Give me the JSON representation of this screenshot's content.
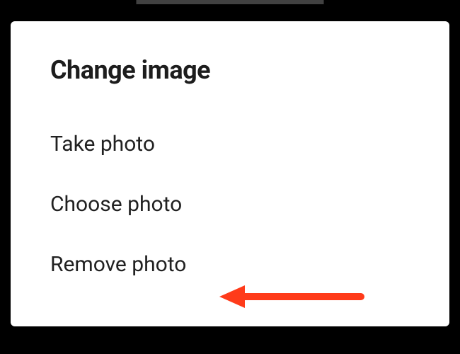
{
  "dialog": {
    "title": "Change image",
    "options": [
      "Take photo",
      "Choose photo",
      "Remove photo"
    ]
  },
  "annotation": {
    "arrow_target": "remove-photo",
    "arrow_color": "#ff3b1a"
  }
}
